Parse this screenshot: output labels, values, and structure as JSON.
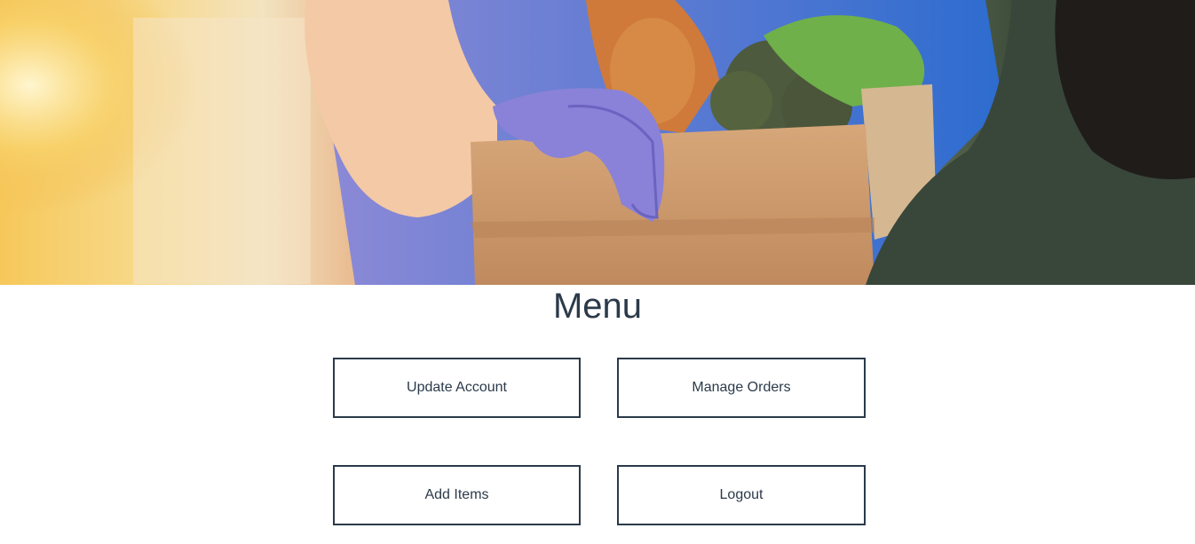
{
  "hero": {
    "image_description_icon": "grocery-delivery-photo"
  },
  "menu": {
    "title": "Menu",
    "buttons": [
      {
        "label": "Update Account"
      },
      {
        "label": "Manage Orders"
      },
      {
        "label": "Add Items"
      },
      {
        "label": "Logout"
      }
    ]
  },
  "colors": {
    "text": "#2b3a4a",
    "border": "#2b3a4a",
    "background": "#ffffff"
  }
}
